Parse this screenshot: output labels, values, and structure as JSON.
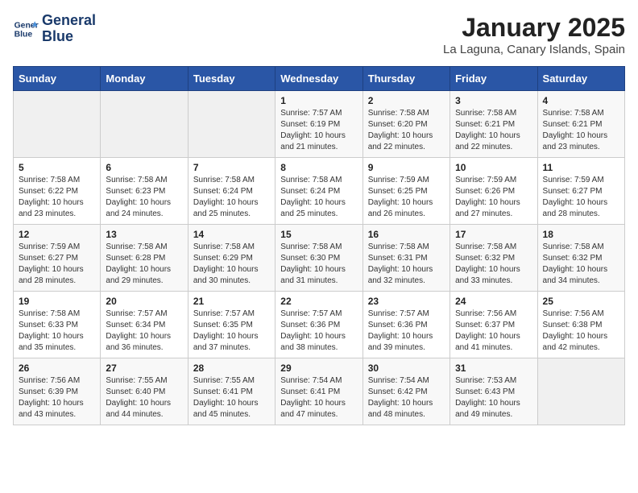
{
  "logo": {
    "line1": "General",
    "line2": "Blue"
  },
  "title": "January 2025",
  "subtitle": "La Laguna, Canary Islands, Spain",
  "weekdays": [
    "Sunday",
    "Monday",
    "Tuesday",
    "Wednesday",
    "Thursday",
    "Friday",
    "Saturday"
  ],
  "weeks": [
    [
      {
        "day": "",
        "info": ""
      },
      {
        "day": "",
        "info": ""
      },
      {
        "day": "",
        "info": ""
      },
      {
        "day": "1",
        "info": "Sunrise: 7:57 AM\nSunset: 6:19 PM\nDaylight: 10 hours\nand 21 minutes."
      },
      {
        "day": "2",
        "info": "Sunrise: 7:58 AM\nSunset: 6:20 PM\nDaylight: 10 hours\nand 22 minutes."
      },
      {
        "day": "3",
        "info": "Sunrise: 7:58 AM\nSunset: 6:21 PM\nDaylight: 10 hours\nand 22 minutes."
      },
      {
        "day": "4",
        "info": "Sunrise: 7:58 AM\nSunset: 6:21 PM\nDaylight: 10 hours\nand 23 minutes."
      }
    ],
    [
      {
        "day": "5",
        "info": "Sunrise: 7:58 AM\nSunset: 6:22 PM\nDaylight: 10 hours\nand 23 minutes."
      },
      {
        "day": "6",
        "info": "Sunrise: 7:58 AM\nSunset: 6:23 PM\nDaylight: 10 hours\nand 24 minutes."
      },
      {
        "day": "7",
        "info": "Sunrise: 7:58 AM\nSunset: 6:24 PM\nDaylight: 10 hours\nand 25 minutes."
      },
      {
        "day": "8",
        "info": "Sunrise: 7:58 AM\nSunset: 6:24 PM\nDaylight: 10 hours\nand 25 minutes."
      },
      {
        "day": "9",
        "info": "Sunrise: 7:59 AM\nSunset: 6:25 PM\nDaylight: 10 hours\nand 26 minutes."
      },
      {
        "day": "10",
        "info": "Sunrise: 7:59 AM\nSunset: 6:26 PM\nDaylight: 10 hours\nand 27 minutes."
      },
      {
        "day": "11",
        "info": "Sunrise: 7:59 AM\nSunset: 6:27 PM\nDaylight: 10 hours\nand 28 minutes."
      }
    ],
    [
      {
        "day": "12",
        "info": "Sunrise: 7:59 AM\nSunset: 6:27 PM\nDaylight: 10 hours\nand 28 minutes."
      },
      {
        "day": "13",
        "info": "Sunrise: 7:58 AM\nSunset: 6:28 PM\nDaylight: 10 hours\nand 29 minutes."
      },
      {
        "day": "14",
        "info": "Sunrise: 7:58 AM\nSunset: 6:29 PM\nDaylight: 10 hours\nand 30 minutes."
      },
      {
        "day": "15",
        "info": "Sunrise: 7:58 AM\nSunset: 6:30 PM\nDaylight: 10 hours\nand 31 minutes."
      },
      {
        "day": "16",
        "info": "Sunrise: 7:58 AM\nSunset: 6:31 PM\nDaylight: 10 hours\nand 32 minutes."
      },
      {
        "day": "17",
        "info": "Sunrise: 7:58 AM\nSunset: 6:32 PM\nDaylight: 10 hours\nand 33 minutes."
      },
      {
        "day": "18",
        "info": "Sunrise: 7:58 AM\nSunset: 6:32 PM\nDaylight: 10 hours\nand 34 minutes."
      }
    ],
    [
      {
        "day": "19",
        "info": "Sunrise: 7:58 AM\nSunset: 6:33 PM\nDaylight: 10 hours\nand 35 minutes."
      },
      {
        "day": "20",
        "info": "Sunrise: 7:57 AM\nSunset: 6:34 PM\nDaylight: 10 hours\nand 36 minutes."
      },
      {
        "day": "21",
        "info": "Sunrise: 7:57 AM\nSunset: 6:35 PM\nDaylight: 10 hours\nand 37 minutes."
      },
      {
        "day": "22",
        "info": "Sunrise: 7:57 AM\nSunset: 6:36 PM\nDaylight: 10 hours\nand 38 minutes."
      },
      {
        "day": "23",
        "info": "Sunrise: 7:57 AM\nSunset: 6:36 PM\nDaylight: 10 hours\nand 39 minutes."
      },
      {
        "day": "24",
        "info": "Sunrise: 7:56 AM\nSunset: 6:37 PM\nDaylight: 10 hours\nand 41 minutes."
      },
      {
        "day": "25",
        "info": "Sunrise: 7:56 AM\nSunset: 6:38 PM\nDaylight: 10 hours\nand 42 minutes."
      }
    ],
    [
      {
        "day": "26",
        "info": "Sunrise: 7:56 AM\nSunset: 6:39 PM\nDaylight: 10 hours\nand 43 minutes."
      },
      {
        "day": "27",
        "info": "Sunrise: 7:55 AM\nSunset: 6:40 PM\nDaylight: 10 hours\nand 44 minutes."
      },
      {
        "day": "28",
        "info": "Sunrise: 7:55 AM\nSunset: 6:41 PM\nDaylight: 10 hours\nand 45 minutes."
      },
      {
        "day": "29",
        "info": "Sunrise: 7:54 AM\nSunset: 6:41 PM\nDaylight: 10 hours\nand 47 minutes."
      },
      {
        "day": "30",
        "info": "Sunrise: 7:54 AM\nSunset: 6:42 PM\nDaylight: 10 hours\nand 48 minutes."
      },
      {
        "day": "31",
        "info": "Sunrise: 7:53 AM\nSunset: 6:43 PM\nDaylight: 10 hours\nand 49 minutes."
      },
      {
        "day": "",
        "info": ""
      }
    ]
  ]
}
